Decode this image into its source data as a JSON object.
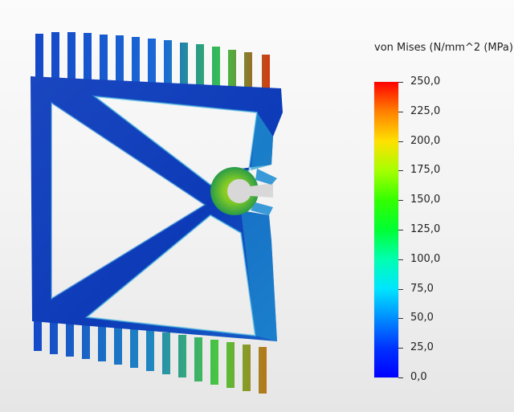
{
  "legend": {
    "title": "von Mises (N/mm^2 (MPa))",
    "min": 0,
    "max": 250,
    "ticks": [
      "250,0",
      "225,0",
      "200,0",
      "175,0",
      "150,0",
      "125,0",
      "100,0",
      "75,0",
      "50,0",
      "25,0",
      "0,0"
    ],
    "tick_values": [
      250,
      225,
      200,
      175,
      150,
      125,
      100,
      75,
      50,
      25,
      0
    ],
    "colors": [
      "#ff0000",
      "#ff8000",
      "#ffe000",
      "#a6ff00",
      "#33ff00",
      "#00ff33",
      "#00ffb0",
      "#00e5ff",
      "#008cff",
      "#0033ff",
      "#0000ff"
    ]
  },
  "model": {
    "base_color": "#0a3fc4",
    "high_stress_color": "#d93a0a",
    "mid_stress_color": "#2fd12a"
  }
}
